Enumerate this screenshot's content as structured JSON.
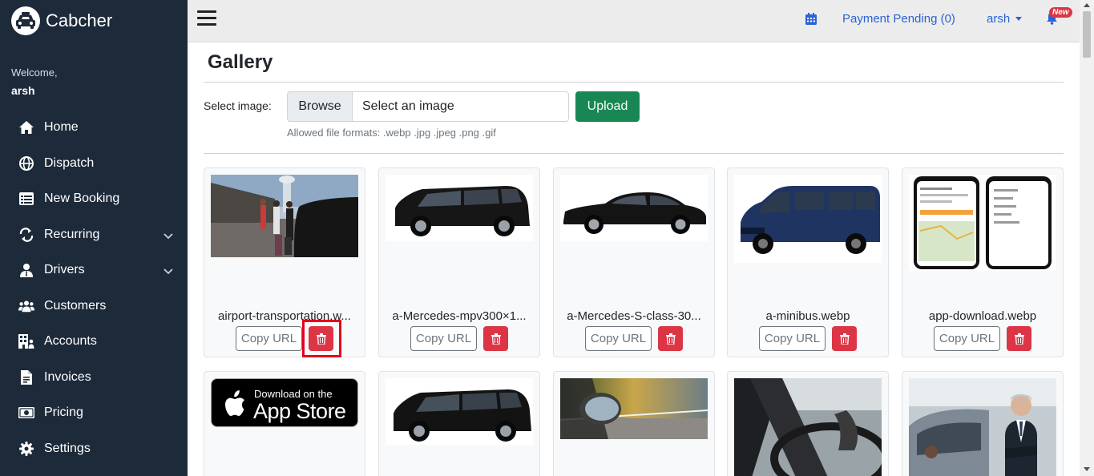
{
  "brand": {
    "name": "Cabcher"
  },
  "welcome": {
    "label": "Welcome,",
    "user": "arsh"
  },
  "nav": [
    {
      "label": "Home",
      "icon": "home-icon"
    },
    {
      "label": "Dispatch",
      "icon": "globe-icon"
    },
    {
      "label": "New Booking",
      "icon": "table-list-icon"
    },
    {
      "label": "Recurring",
      "icon": "repeat-icon",
      "expandable": true
    },
    {
      "label": "Drivers",
      "icon": "user-tie-icon",
      "expandable": true
    },
    {
      "label": "Customers",
      "icon": "users-icon"
    },
    {
      "label": "Accounts",
      "icon": "building-icon"
    },
    {
      "label": "Invoices",
      "icon": "invoice-icon"
    },
    {
      "label": "Pricing",
      "icon": "money-bill-icon"
    },
    {
      "label": "Settings",
      "icon": "gear-icon"
    }
  ],
  "topbar": {
    "payment": "Payment Pending (0)",
    "user": "arsh",
    "badge": "New"
  },
  "page": {
    "title": "Gallery"
  },
  "upload": {
    "label": "Select image:",
    "browse": "Browse",
    "file_placeholder": "Select an image",
    "button": "Upload",
    "formats": "Allowed file formats: .webp .jpg .jpeg .png .gif"
  },
  "gallery": {
    "copy_label": "Copy URL",
    "items": [
      {
        "filename": "airport-transportation.w...",
        "image": "airport-photo"
      },
      {
        "filename": "a-Mercedes-mpv300×1...",
        "image": "black-van"
      },
      {
        "filename": "a-Mercedes-S-class-30...",
        "image": "black-sedan"
      },
      {
        "filename": "a-minibus.webp",
        "image": "blue-minibus"
      },
      {
        "filename": "app-download.webp",
        "image": "app-screens"
      },
      {
        "filename": "",
        "image": "app-store-badge",
        "badge_small": "Download on the",
        "badge_big": "App Store"
      },
      {
        "filename": "",
        "image": "black-van-2"
      },
      {
        "filename": "",
        "image": "mirror-road"
      },
      {
        "filename": "",
        "image": "steering-wheel"
      },
      {
        "filename": "",
        "image": "businessman-car"
      }
    ]
  },
  "colors": {
    "sidebar": "#1d2a3a",
    "link": "#2a63d6",
    "success": "#198754",
    "danger": "#dc3545",
    "highlight": "#e3001b"
  }
}
